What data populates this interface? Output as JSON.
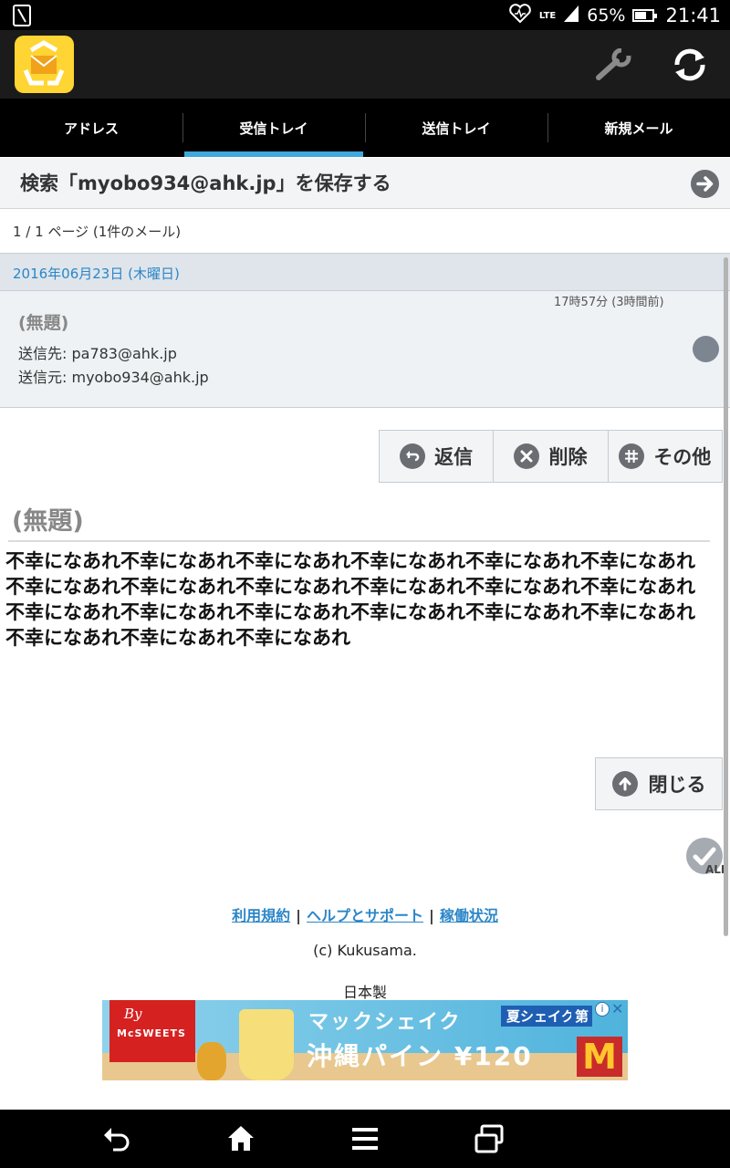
{
  "status_bar": {
    "network": "LTE",
    "battery": "65%",
    "battery_level": 0.65,
    "time": "21:41"
  },
  "tabs": [
    {
      "label": "アドレス",
      "active": false
    },
    {
      "label": "受信トレイ",
      "active": true
    },
    {
      "label": "送信トレイ",
      "active": false
    },
    {
      "label": "新規メール",
      "active": false
    }
  ],
  "save_search": {
    "label": "検索「myobo934@ahk.jp」を保存する"
  },
  "page_info": "1 / 1 ページ (1件のメール)",
  "date_header": "2016年06月23日 (木曜日)",
  "mail_item": {
    "time": "17時57分 (3時間前)",
    "subject": "(無題)",
    "to": "送信先: pa783@ahk.jp",
    "from": "送信元: myobo934@ahk.jp"
  },
  "actions": {
    "reply": "返信",
    "delete": "削除",
    "other": "その他"
  },
  "message": {
    "subject": "(無題)",
    "body": "不幸になあれ不幸になあれ不幸になあれ不幸になあれ不幸になあれ不幸になあれ不幸になあれ不幸になあれ不幸になあれ不幸になあれ不幸になあれ不幸になあれ不幸になあれ不幸になあれ不幸になあれ不幸になあれ不幸になあれ不幸になあれ不幸になあれ不幸になあれ不幸になあれ"
  },
  "close_label": "閉じる",
  "check_all_label": "ALL",
  "footer": {
    "link_terms": "利用規約",
    "link_help": "ヘルプとサポート",
    "link_status": "稼働状況",
    "separator": "|",
    "copyright": "(c) Kukusama.",
    "made_in": "日本製"
  },
  "ad": {
    "brand_by": "By",
    "brand_name": "McSWEETS",
    "title_line1": "マックシェイク",
    "title_line2": "沖縄パイン ¥120",
    "tag": "夏シェイク",
    "tag2": "第",
    "logo": "M",
    "info": "i",
    "close": "✕"
  },
  "colors": {
    "accent": "#3fa8de",
    "link": "#2b86c8",
    "app_icon": "#ffd533"
  }
}
